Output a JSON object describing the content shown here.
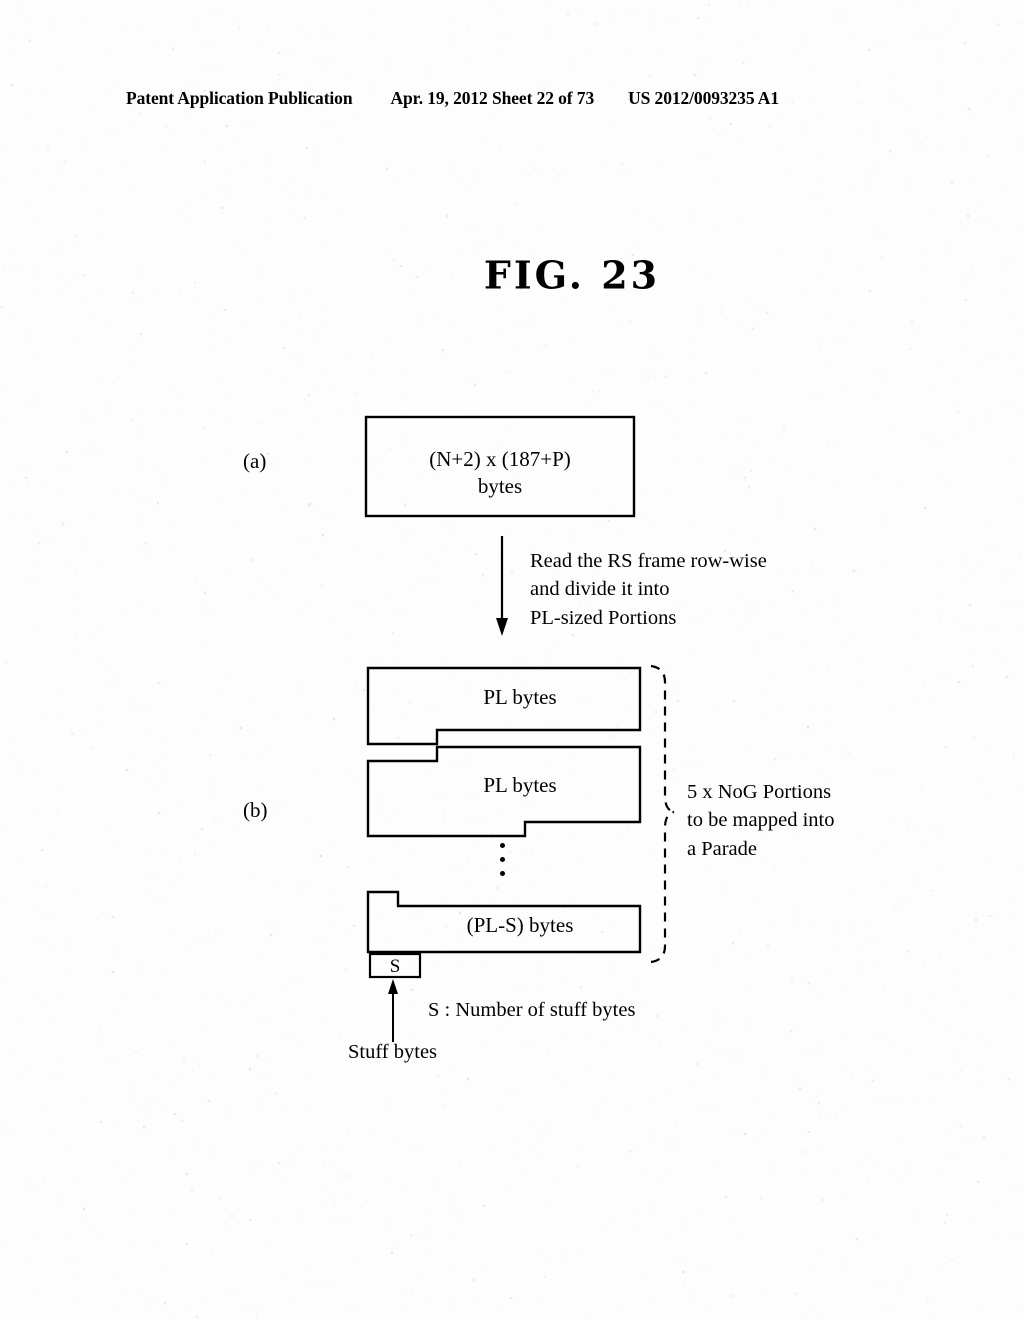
{
  "header": {
    "publication": "Patent Application Publication",
    "date_sheet": "Apr. 19, 2012  Sheet 22 of 73",
    "patent_number": "US 2012/0093235 A1"
  },
  "figure": {
    "title": "FIG. 23",
    "part_a_label": "(a)",
    "part_b_label": "(b)"
  },
  "blocks": {
    "rs_frame_line1": "(N+2)  x (187+P)",
    "rs_frame_line2": "bytes",
    "portion_1": "PL bytes",
    "portion_2": "PL bytes",
    "portion_last": "(PL-S) bytes",
    "stuff_box": "S"
  },
  "annotations": {
    "arrow_note_line1": "Read the RS frame row-wise",
    "arrow_note_line2": "and divide it into",
    "arrow_note_line3": "PL-sized Portions",
    "brace_line1": "5 x NoG Portions",
    "brace_line2": "to be mapped into",
    "brace_line3": "a Parade",
    "stuff_legend": "S : Number of stuff bytes",
    "stuff_arrow_label": "Stuff bytes"
  },
  "colors": {
    "ink": "#000000",
    "paper": "#fdfdfd"
  }
}
